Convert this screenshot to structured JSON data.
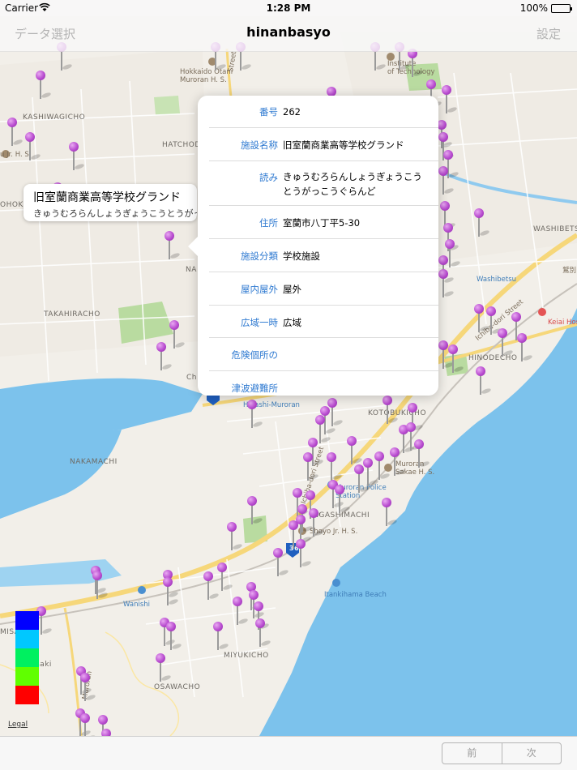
{
  "status_bar": {
    "carrier": "Carrier",
    "time": "1:28 PM",
    "battery": "100%"
  },
  "nav": {
    "left": "データ選択",
    "title": "hinanbasyo",
    "right": "設定"
  },
  "map_labels": {
    "kashiwagicho": "KASHIWAGICHO",
    "hatchodaira": "HATCHOD",
    "takahiracho": "TAKAHIRACHO",
    "nakamachi": "NAKAMACHI",
    "higashimachi": "HIGASHIMACHI",
    "kotobukicho": "KOTOBUKICHO",
    "hinodecho": "HINODECHO",
    "washibetsu_upper": "WASHIBETS",
    "washibetsu": "Washibetsu",
    "miyukicho": "MIYUKICHO",
    "osawacho": "OSAWACHO",
    "wanishi": "Wanishi",
    "itankihama": "Itankihama Beach",
    "police": "Muroran Police\nStation",
    "sakae": "Muroran\nSakae H. S.",
    "shoyo": "Shoyo Jr. H. S.",
    "hokkaido_otani": "Hokkaido Otani\nMuroran H. S.",
    "tech": "Institute\nof Technology",
    "keiai": "Keiai Hospital",
    "higashi_muroran": "Higashi-Muroran",
    "jr_hs": "u Jr. H. S.",
    "route_36": "36",
    "saki": "saki",
    "misa": "MISA",
    "nai": "NA",
    "hoki": "OHOK",
    "chi": "Ch",
    "muroran_street": "Muroran",
    "ichiba_dori": "Ichiba-dori Street",
    "street_upper": "Street",
    "ichiba_right": "Ichiba-dori Street",
    "ichiba_left": "Ichiba-dori Street",
    "kanji_right": "鷲別"
  },
  "legal": "Legal",
  "callout": {
    "title": "旧室蘭商業高等学校グランド",
    "subtitle": "きゅうむろらんしょうぎょうこうとうがっこうぐらんど"
  },
  "popover": {
    "rows": [
      {
        "label": "番号",
        "value": "262"
      },
      {
        "label": "施設名称",
        "value": "旧室蘭商業高等学校グランド"
      },
      {
        "label": "読み",
        "value": "きゅうむろらんしょうぎょうこうとうがっこうぐらんど"
      },
      {
        "label": "住所",
        "value": "室蘭市八丁平5-30"
      },
      {
        "label": "施設分類",
        "value": "学校施設"
      },
      {
        "label": "屋内屋外",
        "value": "屋外"
      },
      {
        "label": "広域一時",
        "value": "広域"
      },
      {
        "label": "危険個所の",
        "value": ""
      },
      {
        "label": "津波避難所",
        "value": ""
      }
    ]
  },
  "legend_colors": [
    "#0000ff",
    "#00c8ff",
    "#00f060",
    "#60ff00",
    "#ff0000"
  ],
  "pin_color": "#b94dd0",
  "toolbar": {
    "prev": "前",
    "next": "次"
  }
}
